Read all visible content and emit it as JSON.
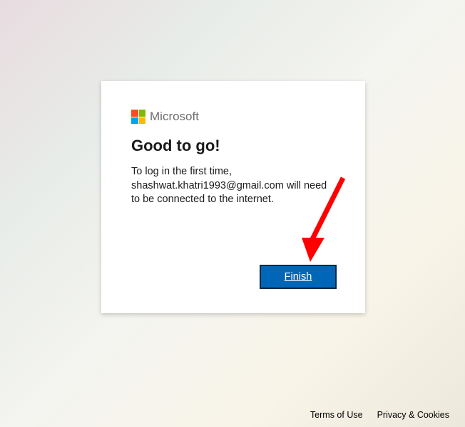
{
  "brand": {
    "name": "Microsoft"
  },
  "dialog": {
    "heading": "Good to go!",
    "body": "To log in the first time, shashwat.khatri1993@gmail.com will need to be connected to the internet.",
    "finish_label": "Finish"
  },
  "footer": {
    "terms": "Terms of Use",
    "privacy": "Privacy & Cookies"
  }
}
